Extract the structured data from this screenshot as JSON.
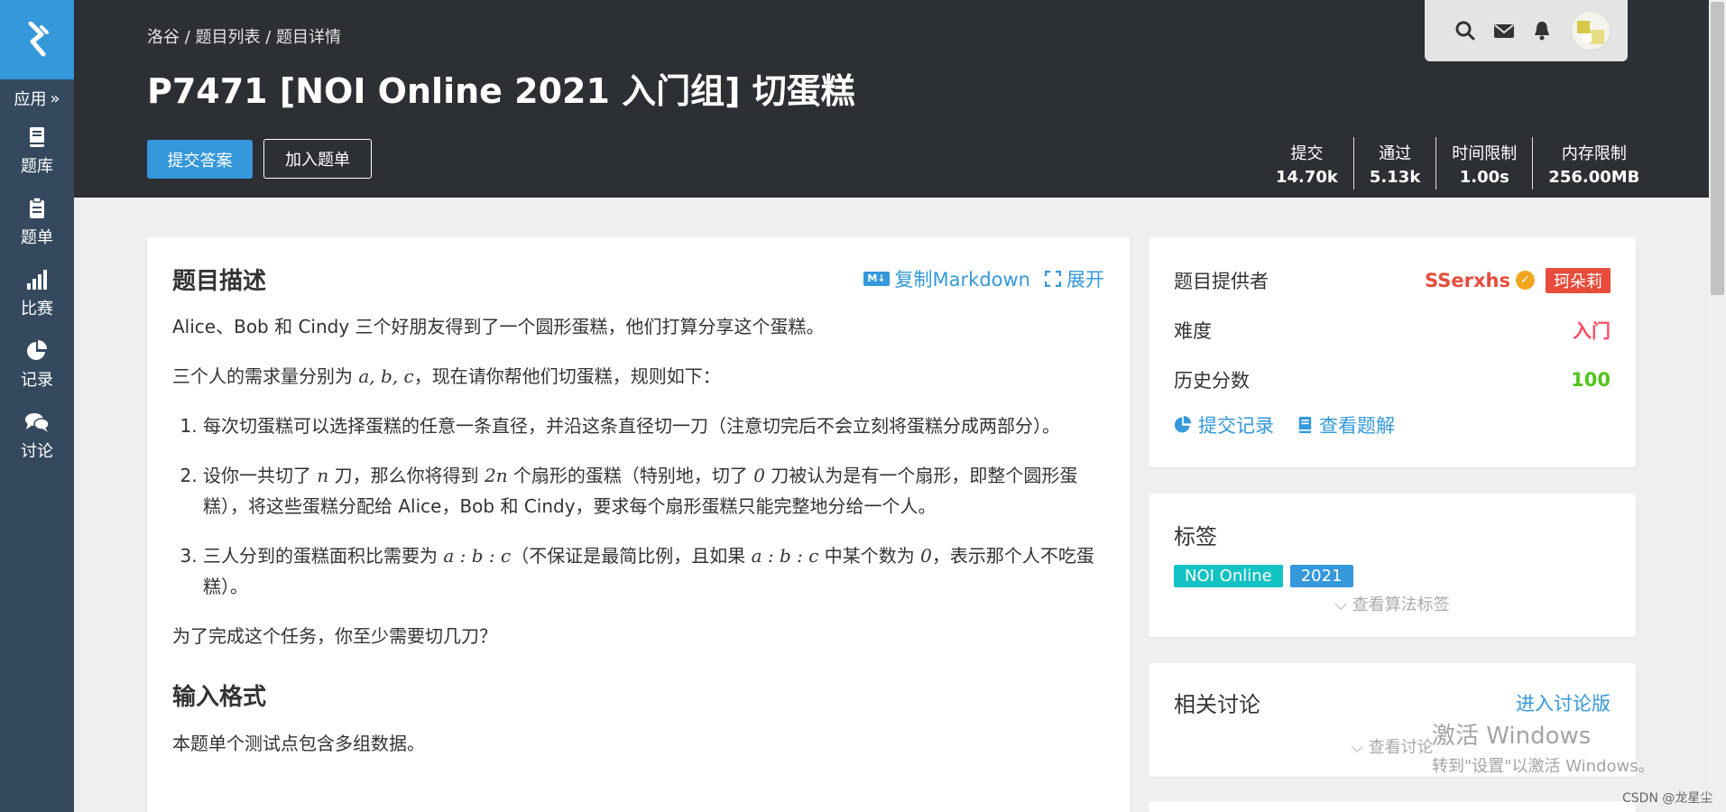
{
  "sidebar": {
    "logo_icon": "luogu-logo-icon",
    "apps_label": "应用",
    "items": [
      {
        "label": "题库",
        "icon": "book-icon"
      },
      {
        "label": "题单",
        "icon": "clipboard-icon"
      },
      {
        "label": "比赛",
        "icon": "bar-chart-icon"
      },
      {
        "label": "记录",
        "icon": "pie-chart-icon"
      },
      {
        "label": "讨论",
        "icon": "comments-icon"
      }
    ]
  },
  "header": {
    "breadcrumb": [
      "洛谷",
      "题目列表",
      "题目详情"
    ],
    "breadcrumb_sep": " / ",
    "title": "P7471 [NOI Online 2021 入门组] 切蛋糕",
    "submit_label": "提交答案",
    "add_list_label": "加入题单",
    "stats": [
      {
        "label": "提交",
        "value": "14.70k"
      },
      {
        "label": "通过",
        "value": "5.13k"
      },
      {
        "label": "时间限制",
        "value": "1.00s"
      },
      {
        "label": "内存限制",
        "value": "256.00MB"
      }
    ]
  },
  "description": {
    "title": "题目描述",
    "copy_markdown_label": "复制Markdown",
    "md_badge": "M↓",
    "expand_label": "展开",
    "p1": "Alice、Bob 和 Cindy 三个好朋友得到了一个圆形蛋糕，他们打算分享这个蛋糕。",
    "p2_a": "三个人的需求量分别为 ",
    "p2_math": "a, b, c",
    "p2_b": "，现在请你帮他们切蛋糕，规则如下：",
    "rule1": "每次切蛋糕可以选择蛋糕的任意一条直径，并沿这条直径切一刀（注意切完后不会立刻将蛋糕分成两部分）。",
    "rule2_a": "设你一共切了 ",
    "rule2_m1": "n",
    "rule2_b": " 刀，那么你将得到 ",
    "rule2_m2": "2n",
    "rule2_c": " 个扇形的蛋糕（特别地，切了 ",
    "rule2_m3": "0",
    "rule2_d": " 刀被认为是有一个扇形，即整个圆形蛋糕），将这些蛋糕分配给 Alice，Bob 和 Cindy，要求每个扇形蛋糕只能完整地分给一个人。",
    "rule3_a": "三人分到的蛋糕面积比需要为 ",
    "rule3_m1": "a : b : c",
    "rule3_b": "（不保证是最简比例，且如果 ",
    "rule3_m2": "a : b : c",
    "rule3_c": " 中某个数为 ",
    "rule3_m3": "0",
    "rule3_d": "，表示那个人不吃蛋糕）。",
    "p3": "为了完成这个任务，你至少需要切几刀？",
    "input_title": "输入格式",
    "input_p": "本题单个测试点包含多组数据。"
  },
  "info": {
    "provider_label": "题目提供者",
    "provider_name": "SSerxhs",
    "provider_badge": "珂朵莉",
    "difficulty_label": "难度",
    "difficulty_value": "入门",
    "score_label": "历史分数",
    "score_value": "100",
    "submissions_link": "提交记录",
    "solutions_link": "查看题解"
  },
  "tags": {
    "title": "标签",
    "items": [
      "NOI Online",
      "2021"
    ],
    "view_label": "查看算法标签"
  },
  "discussion": {
    "title": "相关讨论",
    "enter_label": "进入讨论版",
    "view_label": "查看讨论"
  },
  "overlays": {
    "win_line1": "激活 Windows",
    "win_line2": "转到\"设置\"以激活 Windows。",
    "csdn": "CSDN @龙星尘"
  },
  "colors": {
    "sidebar_bg": "#34495e",
    "header_bg": "#2c2f33",
    "accent": "#3498db",
    "difficulty_red": "#fe4c61",
    "score_green": "#52c41a",
    "tag_cyan": "#13c2c2"
  }
}
